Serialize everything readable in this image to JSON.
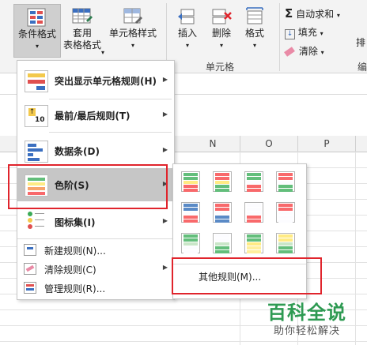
{
  "ribbon": {
    "conditional_format": {
      "label": "条件格式",
      "arrow": "▾"
    },
    "table_format": {
      "label1": "套用",
      "label2": "表格格式",
      "arrow": "▾"
    },
    "cell_style": {
      "label": "单元格样式",
      "arrow": "▾"
    },
    "insert": {
      "label": "插入",
      "arrow": "▾"
    },
    "delete": {
      "label": "删除",
      "arrow": "▾"
    },
    "format": {
      "label": "格式",
      "arrow": "▾"
    },
    "autosum": {
      "label": "自动求和",
      "arrow": "▾"
    },
    "fill": {
      "label": "填充",
      "arrow": "▾"
    },
    "clear": {
      "label": "清除",
      "arrow": "▾"
    },
    "sort_partial": "排",
    "cells_group": "单元格",
    "edit_group_partial": "编"
  },
  "columns": [
    "N",
    "O",
    "P"
  ],
  "menu": {
    "items": [
      {
        "label": "突出显示单元格规则(H)",
        "icon": "highlight-rules-icon"
      },
      {
        "label": "最前/最后规则(T)",
        "icon": "top-bottom-rules-icon"
      },
      {
        "label": "数据条(D)",
        "icon": "data-bars-icon"
      },
      {
        "label": "色阶(S)",
        "icon": "color-scales-icon"
      },
      {
        "label": "图标集(I)",
        "icon": "icon-sets-icon"
      }
    ],
    "small_items": [
      {
        "label": "新建规则(N)...",
        "icon": "new-rule-icon"
      },
      {
        "label": "清除规则(C)",
        "icon": "clear-rules-icon"
      },
      {
        "label": "管理规则(R)...",
        "icon": "manage-rules-icon"
      }
    ],
    "arrow": "▶"
  },
  "submenu": {
    "more_rules": "其他规则(M)...",
    "scales": [
      [
        "#63be7b",
        "#ffeb84",
        "#f8696b"
      ],
      [
        "#f8696b",
        "#ffeb84",
        "#63be7b"
      ],
      [
        "#63be7b",
        "#fcfcff",
        "#f8696b"
      ],
      [
        "#f8696b",
        "#fcfcff",
        "#63be7b"
      ],
      [
        "#5a8ac6",
        "#fcfcff",
        "#f8696b"
      ],
      [
        "#f8696b",
        "#fcfcff",
        "#5a8ac6"
      ],
      [
        "#fcfcff",
        "#fcfcff",
        "#f8696b"
      ],
      [
        "#f8696b",
        "#fcfcff",
        "#fcfcff"
      ],
      [
        "#63be7b",
        "#c9e6c8",
        "#fcfcff"
      ],
      [
        "#fcfcff",
        "#c9e6c8",
        "#63be7b"
      ],
      [
        "#63be7b",
        "#ffeb84",
        "#ffef9c"
      ],
      [
        "#ffeb84",
        "#c9e6c8",
        "#63be7b"
      ]
    ]
  },
  "watermark": {
    "title": "百科全说",
    "subtitle": "助你轻松解决"
  }
}
